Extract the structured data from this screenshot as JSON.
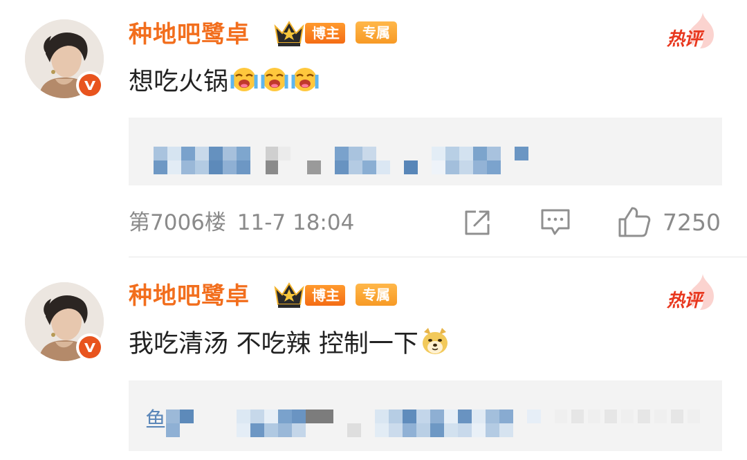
{
  "comments": [
    {
      "username": "种地吧鹭卓",
      "badges": {
        "blogger": "博主",
        "exclusive": "专属"
      },
      "hot_label": "热评",
      "text": "想吃火锅",
      "emoji_icons": [
        "laugh-cry-emoji",
        "laugh-cry-emoji",
        "laugh-cry-emoji"
      ],
      "floor": "第7006楼",
      "time": "11-7 18:04",
      "likes": "7250"
    },
    {
      "username": "种地吧鹭卓",
      "badges": {
        "blogger": "博主",
        "exclusive": "专属"
      },
      "hot_label": "热评",
      "text": "我吃清汤 不吃辣 控制一下",
      "emoji_icons": [
        "doge-emoji"
      ],
      "reply_prefix": " 鱼"
    }
  ],
  "colors": {
    "username": "#f26e1d",
    "hot": "#e8371e",
    "meta": "#8a8a8a",
    "reply_bg": "#f3f3f3",
    "verified": "#e8541e"
  },
  "icons": [
    "share-icon",
    "comment-icon",
    "thumbs-up-icon",
    "verified-v-icon",
    "crown-icon",
    "flame-icon"
  ]
}
